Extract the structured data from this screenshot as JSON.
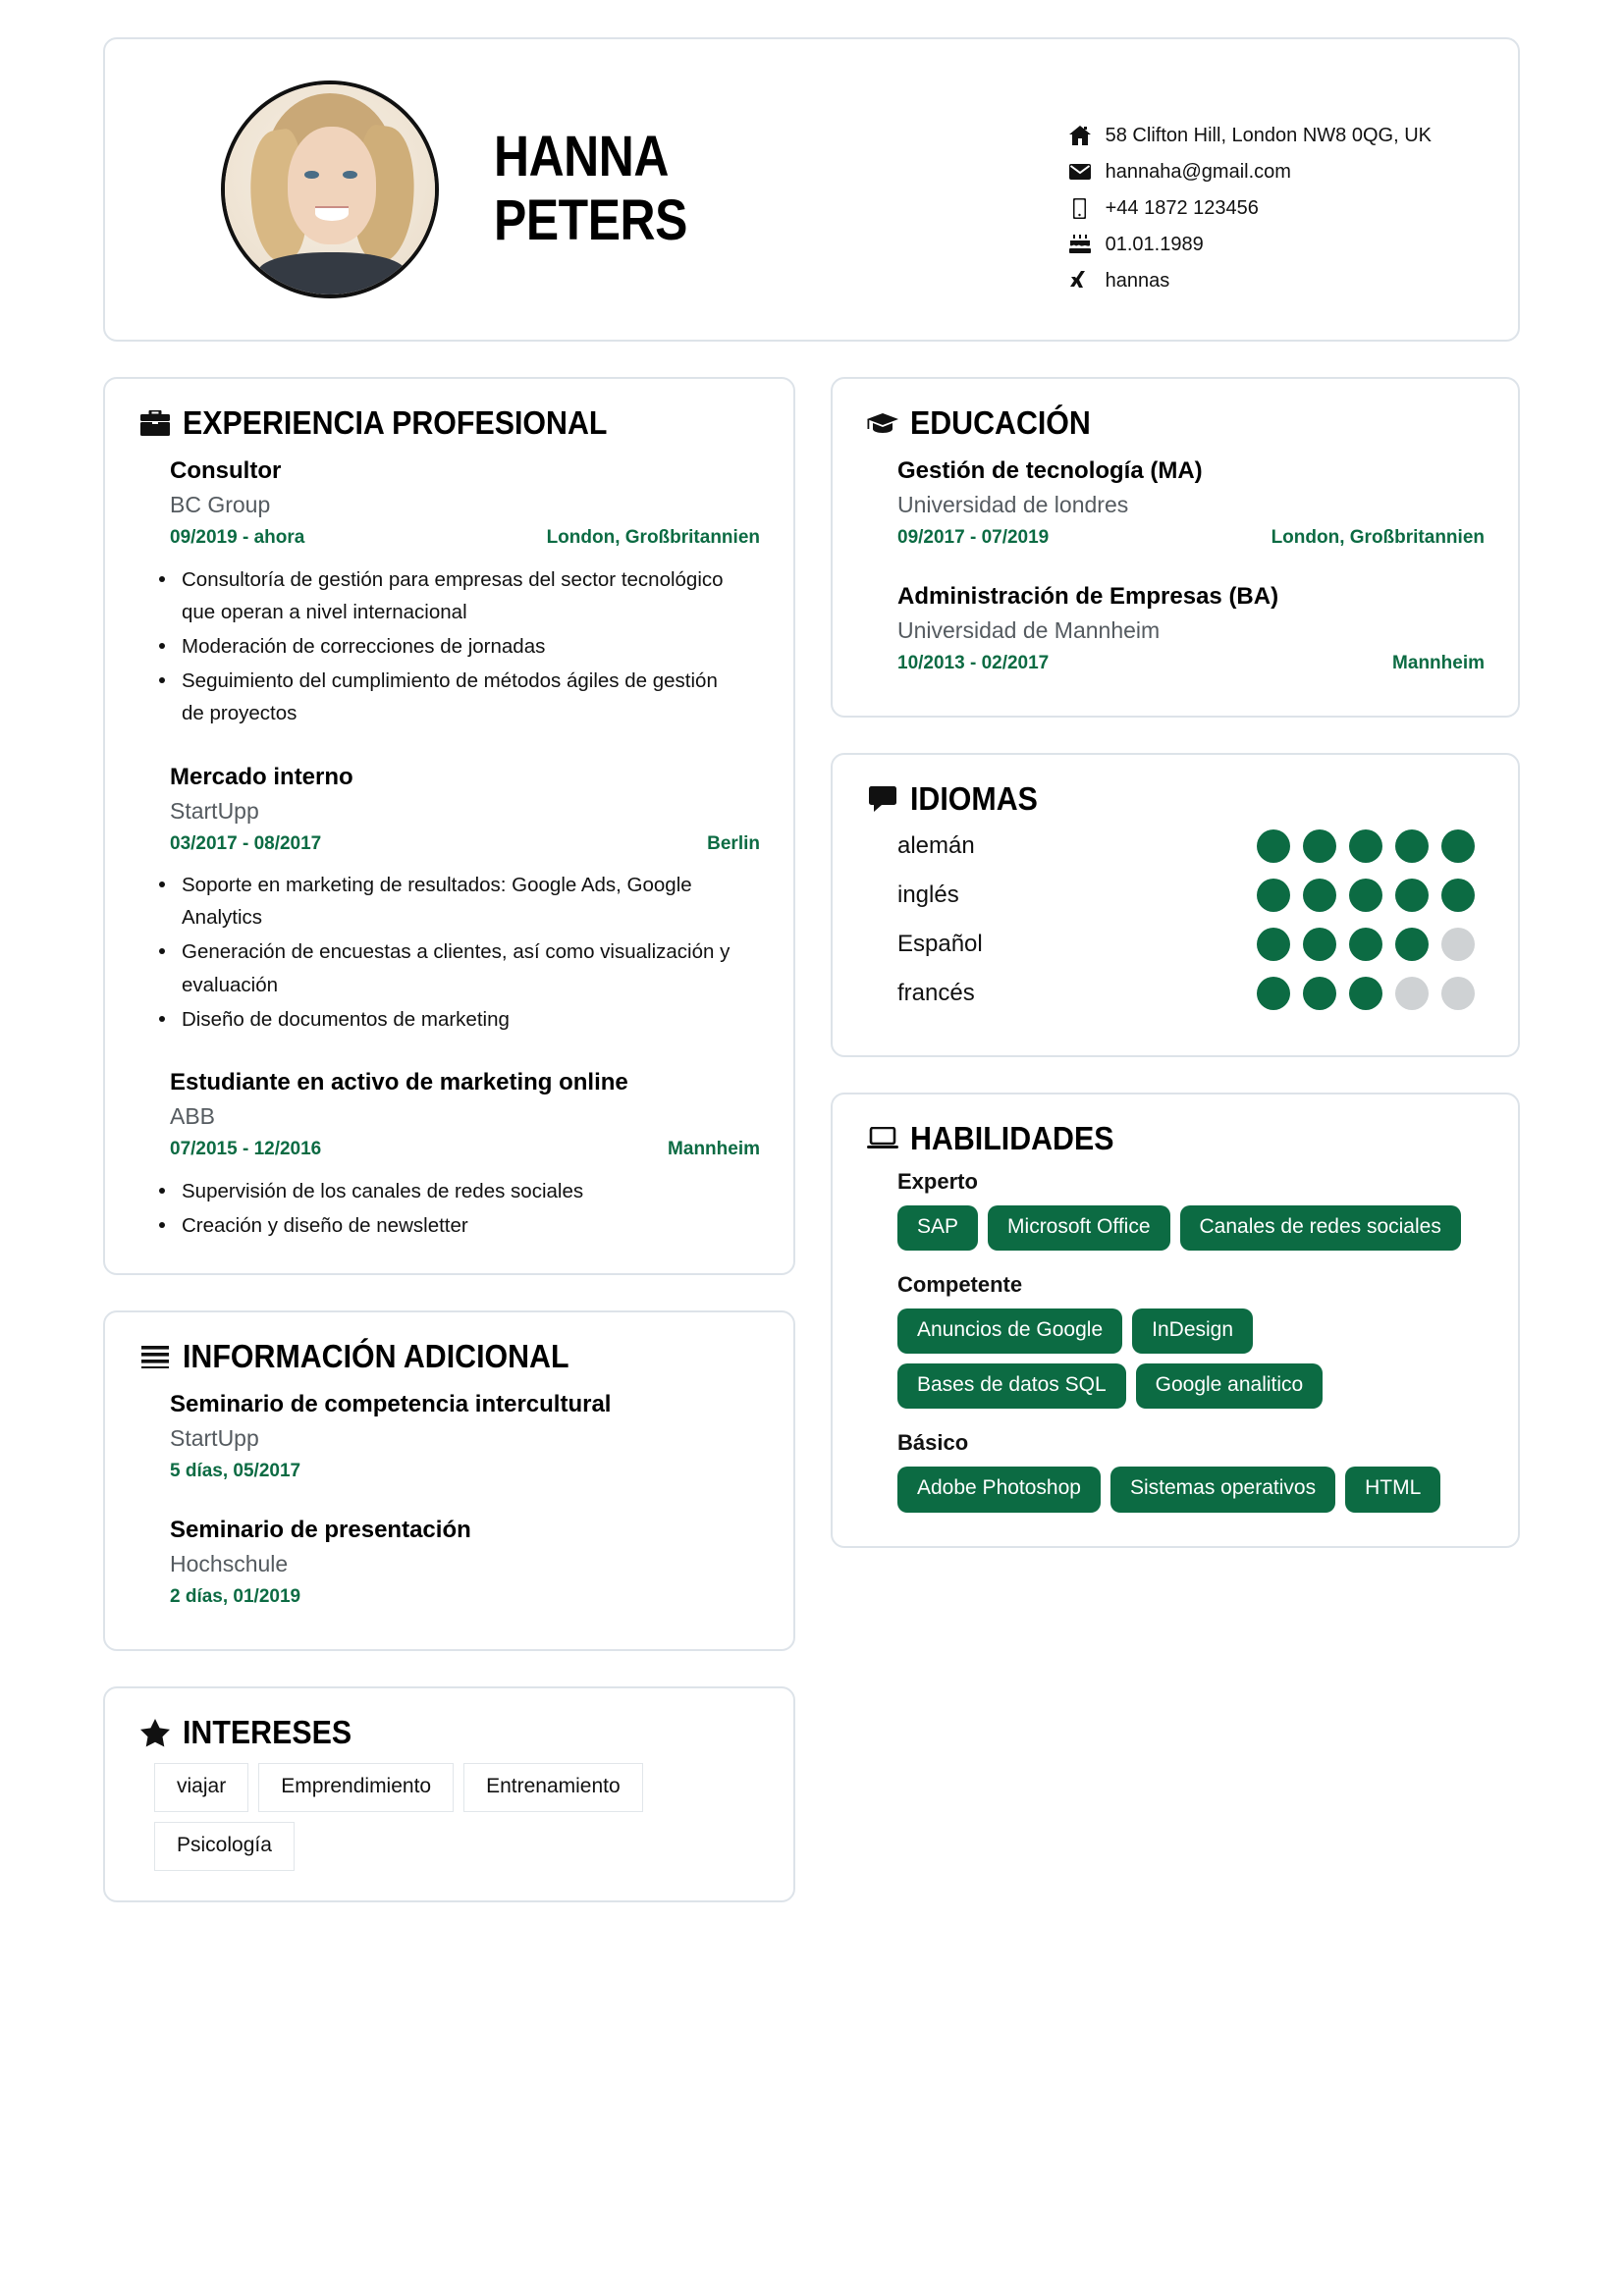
{
  "header": {
    "first_name": "HANNA",
    "last_name": "PETERS",
    "avatar_alt": "portrait-photo",
    "contacts": [
      {
        "icon": "home-icon",
        "text": "58 Clifton Hill, London NW8 0QG, UK"
      },
      {
        "icon": "envelope-icon",
        "text": "hannaha@gmail.com"
      },
      {
        "icon": "mobile-icon",
        "text": "+44 1872 123456"
      },
      {
        "icon": "birthday-cake-icon",
        "text": "01.01.1989"
      },
      {
        "icon": "xing-icon",
        "text": "hannas"
      }
    ]
  },
  "experience": {
    "icon": "briefcase-icon",
    "title": "EXPERIENCIA PROFESIONAL",
    "entries": [
      {
        "title": "Consultor",
        "company": "BC Group",
        "dates": "09/2019 - ahora",
        "location": "London, Großbritannien",
        "bullets": [
          "Consultoría de gestión para empresas del sector tecnológico que operan a nivel internacional",
          "Moderación de correcciones de jornadas",
          "Seguimiento del cumplimiento de métodos ágiles de gestión de proyectos"
        ]
      },
      {
        "title": "Mercado interno",
        "company": "StartUpp",
        "dates": "03/2017 - 08/2017",
        "location": "Berlin",
        "bullets": [
          "Soporte en marketing de resultados: Google Ads, Google Analytics",
          "Generación de encuestas a clientes, así como visualización y evaluación",
          "Diseño de documentos de marketing"
        ]
      },
      {
        "title": "Estudiante en activo de marketing online",
        "company": "ABB",
        "dates": "07/2015 - 12/2016",
        "location": "Mannheim",
        "bullets": [
          "Supervisión de los canales de redes sociales",
          "Creación y diseño de newsletter"
        ]
      }
    ]
  },
  "additional": {
    "icon": "list-icon",
    "title": "INFORMACIÓN ADICIONAL",
    "entries": [
      {
        "title": "Seminario de competencia intercultural",
        "company": "StartUpp",
        "dates": "5 días, 05/2017",
        "location": ""
      },
      {
        "title": "Seminario de presentación",
        "company": "Hochschule",
        "dates": "2 días, 01/2019",
        "location": ""
      }
    ]
  },
  "interests": {
    "icon": "star-icon",
    "title": "INTERESES",
    "items": [
      "viajar",
      "Emprendimiento",
      "Entrenamiento",
      "Psicología"
    ]
  },
  "education": {
    "icon": "graduation-cap-icon",
    "title": "EDUCACIÓN",
    "entries": [
      {
        "title": "Gestión de tecnología (MA)",
        "school": "Universidad de londres",
        "dates": "09/2017 - 07/2019",
        "location": "London, Großbritannien"
      },
      {
        "title": "Administración de Empresas (BA)",
        "school": "Universidad de Mannheim",
        "dates": "10/2013 - 02/2017",
        "location": "Mannheim"
      }
    ]
  },
  "languages": {
    "icon": "speech-bubble-icon",
    "title": "IDIOMAS",
    "max_rating": 5,
    "items": [
      {
        "name": "alemán",
        "rating": 5
      },
      {
        "name": "inglés",
        "rating": 5
      },
      {
        "name": "Español",
        "rating": 4
      },
      {
        "name": "francés",
        "rating": 3
      }
    ]
  },
  "skills": {
    "icon": "laptop-icon",
    "title": "HABILIDADES",
    "groups": [
      {
        "level": "Experto",
        "items": [
          "SAP",
          "Microsoft Office",
          "Canales de redes sociales"
        ]
      },
      {
        "level": "Competente",
        "items": [
          "Anuncios de Google",
          "InDesign",
          "Bases de datos SQL",
          "Google analitico"
        ]
      },
      {
        "level": "Básico",
        "items": [
          "Adobe Photoshop",
          "Sistemas operativos",
          "HTML"
        ]
      }
    ]
  },
  "theme": {
    "accent": "#0c6b43",
    "dot_off": "#cfd2d4",
    "card_border": "#dde3e9",
    "text": "#111111",
    "muted": "#555b60"
  }
}
